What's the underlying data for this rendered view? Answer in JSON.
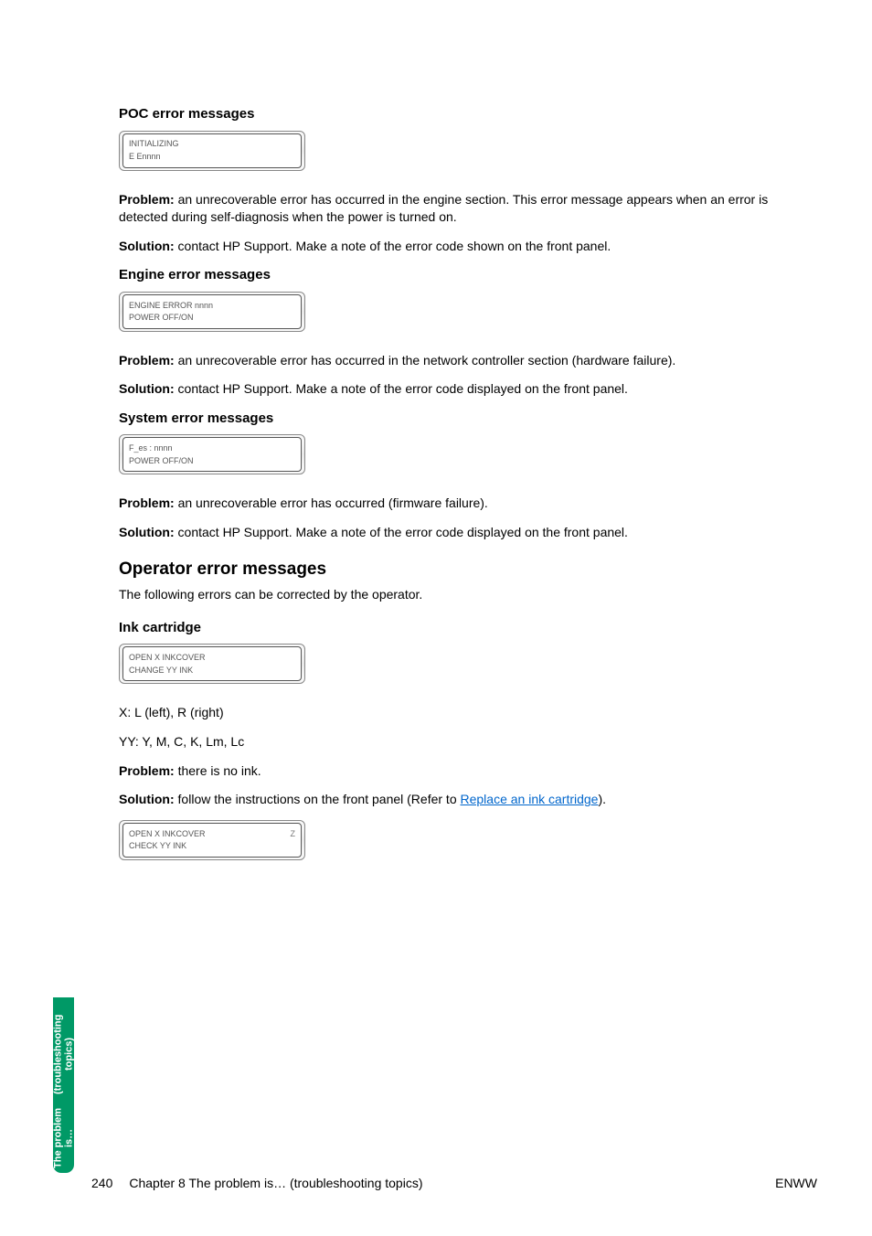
{
  "sections": {
    "poc": {
      "title": "POC error messages",
      "lcd": {
        "line1": "INITIALIZING",
        "line2": "E Ennnn"
      },
      "problem_label": "Problem:",
      "problem_text": " an unrecoverable error has occurred in the engine section. This error message appears when an error is detected during self-diagnosis when the power is turned on.",
      "solution_label": "Solution:",
      "solution_text": " contact HP Support. Make a note of the error code shown on the front panel."
    },
    "engine": {
      "title": "Engine error messages",
      "lcd": {
        "line1": "ENGINE ERROR nnnn",
        "line2": "POWER OFF/ON"
      },
      "problem_label": "Problem:",
      "problem_text": " an unrecoverable error has occurred in the network controller section (hardware failure).",
      "solution_label": "Solution:",
      "solution_text": " contact HP Support. Make a note of the error code displayed on the front panel."
    },
    "system": {
      "title": "System error messages",
      "lcd": {
        "line1": "F_es : nnnn",
        "line2": "POWER OFF/ON"
      },
      "problem_label": "Problem:",
      "problem_text": " an unrecoverable error has occurred (firmware failure).",
      "solution_label": "Solution:",
      "solution_text": " contact HP Support. Make a note of the error code displayed on the front panel."
    },
    "operator": {
      "title": "Operator error messages",
      "intro": "The following errors can be corrected by the operator."
    },
    "ink": {
      "title": "Ink cartridge",
      "lcd1": {
        "line1": "OPEN X INKCOVER",
        "line2": "CHANGE YY INK"
      },
      "x_line": "X: L (left), R (right)",
      "yy_line": "YY: Y, M, C, K, Lm, Lc",
      "problem_label": "Problem:",
      "problem_text": " there is no ink.",
      "solution_label": "Solution:",
      "solution_pre": " follow the instructions on the front panel (Refer to ",
      "solution_link": "Replace an ink cartridge",
      "solution_post": ").",
      "lcd2": {
        "line1": "OPEN X INKCOVER",
        "line1_right": "Z",
        "line2": "CHECK YY INK"
      }
    }
  },
  "sideTab": {
    "line1": "The problem is…",
    "line2": "(troubleshooting topics)"
  },
  "footer": {
    "pageNum": "240",
    "chapter": "Chapter 8   The problem is… (troubleshooting topics)",
    "right": "ENWW"
  }
}
